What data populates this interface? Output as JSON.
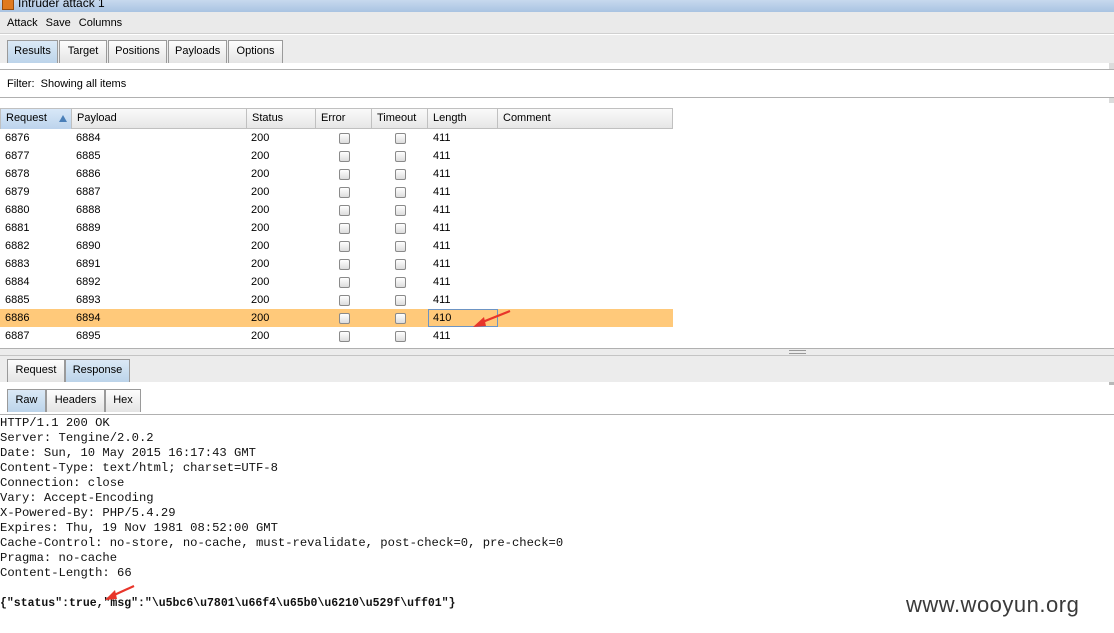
{
  "window": {
    "title": "Intruder attack 1"
  },
  "menu": [
    "Attack",
    "Save",
    "Columns"
  ],
  "main_tabs": [
    "Results",
    "Target",
    "Positions",
    "Payloads",
    "Options"
  ],
  "filter": {
    "label": "Filter:",
    "text": "Showing all items"
  },
  "table": {
    "columns": [
      "Request",
      "Payload",
      "Status",
      "Error",
      "Timeout",
      "Length",
      "Comment"
    ],
    "sorted_column": "Request",
    "rows": [
      {
        "request": "6876",
        "payload": "6884",
        "status": "200",
        "error": false,
        "timeout": false,
        "length": "411",
        "comment": ""
      },
      {
        "request": "6877",
        "payload": "6885",
        "status": "200",
        "error": false,
        "timeout": false,
        "length": "411",
        "comment": ""
      },
      {
        "request": "6878",
        "payload": "6886",
        "status": "200",
        "error": false,
        "timeout": false,
        "length": "411",
        "comment": ""
      },
      {
        "request": "6879",
        "payload": "6887",
        "status": "200",
        "error": false,
        "timeout": false,
        "length": "411",
        "comment": ""
      },
      {
        "request": "6880",
        "payload": "6888",
        "status": "200",
        "error": false,
        "timeout": false,
        "length": "411",
        "comment": ""
      },
      {
        "request": "6881",
        "payload": "6889",
        "status": "200",
        "error": false,
        "timeout": false,
        "length": "411",
        "comment": ""
      },
      {
        "request": "6882",
        "payload": "6890",
        "status": "200",
        "error": false,
        "timeout": false,
        "length": "411",
        "comment": ""
      },
      {
        "request": "6883",
        "payload": "6891",
        "status": "200",
        "error": false,
        "timeout": false,
        "length": "411",
        "comment": ""
      },
      {
        "request": "6884",
        "payload": "6892",
        "status": "200",
        "error": false,
        "timeout": false,
        "length": "411",
        "comment": ""
      },
      {
        "request": "6885",
        "payload": "6893",
        "status": "200",
        "error": false,
        "timeout": false,
        "length": "411",
        "comment": ""
      },
      {
        "request": "6886",
        "payload": "6894",
        "status": "200",
        "error": false,
        "timeout": false,
        "length": "410",
        "comment": "",
        "selected": true
      },
      {
        "request": "6887",
        "payload": "6895",
        "status": "200",
        "error": false,
        "timeout": false,
        "length": "411",
        "comment": ""
      }
    ]
  },
  "detail_tabs": [
    "Request",
    "Response"
  ],
  "detail_active": "Response",
  "view_tabs": [
    "Raw",
    "Headers",
    "Hex"
  ],
  "view_active": "Raw",
  "response": {
    "headers": [
      "HTTP/1.1 200 OK",
      "Server: Tengine/2.0.2",
      "Date: Sun, 10 May 2015 16:17:43 GMT",
      "Content-Type: text/html; charset=UTF-8",
      "Connection: close",
      "Vary: Accept-Encoding",
      "X-Powered-By: PHP/5.4.29",
      "Expires: Thu, 19 Nov 1981 08:52:00 GMT",
      "Cache-Control: no-store, no-cache, must-revalidate, post-check=0, pre-check=0",
      "Pragma: no-cache",
      "Content-Length: 66"
    ],
    "body": "{\"status\":true,\"msg\":\"\\u5bc6\\u7801\\u66f4\\u65b0\\u6210\\u529f\\uff01\"}"
  },
  "watermark": "www.wooyun.org",
  "colors": {
    "selected_row": "#ffc97a",
    "annotation_arrow": "#e8352a",
    "active_tab": "#bcd4ea"
  }
}
